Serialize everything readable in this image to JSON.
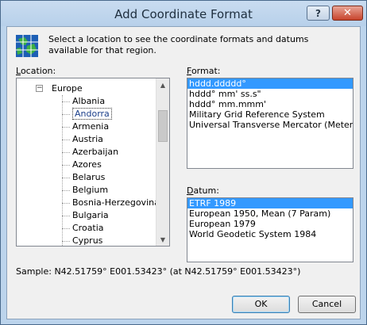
{
  "window": {
    "title": "Add Coordinate Format",
    "help_label": "?",
    "close_label": "✕"
  },
  "intro": {
    "text": "Select a location to see the coordinate formats and datums available for that region."
  },
  "location": {
    "label": "Location:",
    "underline": "L",
    "rest": "ocation:",
    "tree": {
      "parent": "Europe",
      "children": [
        "Albania",
        "Andorra",
        "Armenia",
        "Austria",
        "Azerbaijan",
        "Azores",
        "Belarus",
        "Belgium",
        "Bosnia-Herzegovina",
        "Bulgaria",
        "Croatia",
        "Cyprus"
      ],
      "selected": "Andorra"
    }
  },
  "format": {
    "underline": "F",
    "rest": "ormat:",
    "items": [
      "hddd.ddddd°",
      "hddd° mm' ss.s\"",
      "hddd° mm.mmm'",
      "Military Grid Reference System",
      "Universal Transverse Mercator (Meters)"
    ],
    "selected": "hddd.ddddd°"
  },
  "datum": {
    "underline": "D",
    "rest": "atum:",
    "items": [
      "ETRF 1989",
      "European 1950, Mean (7 Param)",
      "European 1979",
      "World Geodetic System 1984"
    ],
    "selected": "ETRF 1989"
  },
  "sample": {
    "text": "Sample: N42.51759°  E001.53423° (at N42.51759°  E001.53423°)"
  },
  "buttons": {
    "ok": "OK",
    "cancel": "Cancel"
  },
  "colors": {
    "selection": "#3399ff",
    "frame": "#bcd4ec",
    "close_button": "#c8432c"
  }
}
